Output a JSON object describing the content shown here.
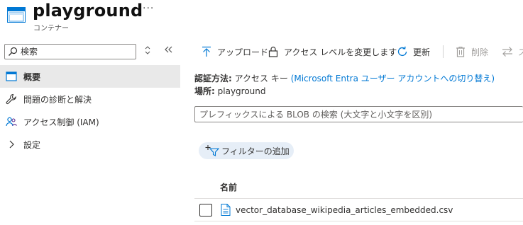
{
  "header": {
    "title": "playground",
    "subtitle": "コンテナー",
    "more": "···"
  },
  "sidebar": {
    "search_placeholder": "検索",
    "items": [
      {
        "label": "概要",
        "icon": "overview-icon",
        "active": true
      },
      {
        "label": "問題の診断と解決",
        "icon": "wrench-icon",
        "active": false
      },
      {
        "label": "アクセス制御 (IAM)",
        "icon": "people-icon",
        "active": false
      },
      {
        "label": "設定",
        "icon": "chevron-right-icon",
        "active": false
      }
    ]
  },
  "toolbar": {
    "upload": "アップロード",
    "access_level": "アクセス レベルを変更します",
    "refresh": "更新",
    "delete": "削除",
    "switch": "ス"
  },
  "main": {
    "auth_label": "認証方法:",
    "auth_value": "アクセス キー",
    "auth_link": "(Microsoft Entra ユーザー アカウントへの切り替え)",
    "location_label": "場所:",
    "location_value": "playground",
    "prefix_placeholder": "プレフィックスによる BLOB の検索 (大文字と小文字を区別)",
    "add_filter": "フィルターの追加",
    "column_name": "名前",
    "files": [
      {
        "name": "vector_database_wikipedia_articles_embedded.csv"
      }
    ]
  },
  "colors": {
    "accent": "#0078d4",
    "active_nav_bg": "#e9e9e9",
    "filter_pill_bg": "#e6eef7"
  }
}
